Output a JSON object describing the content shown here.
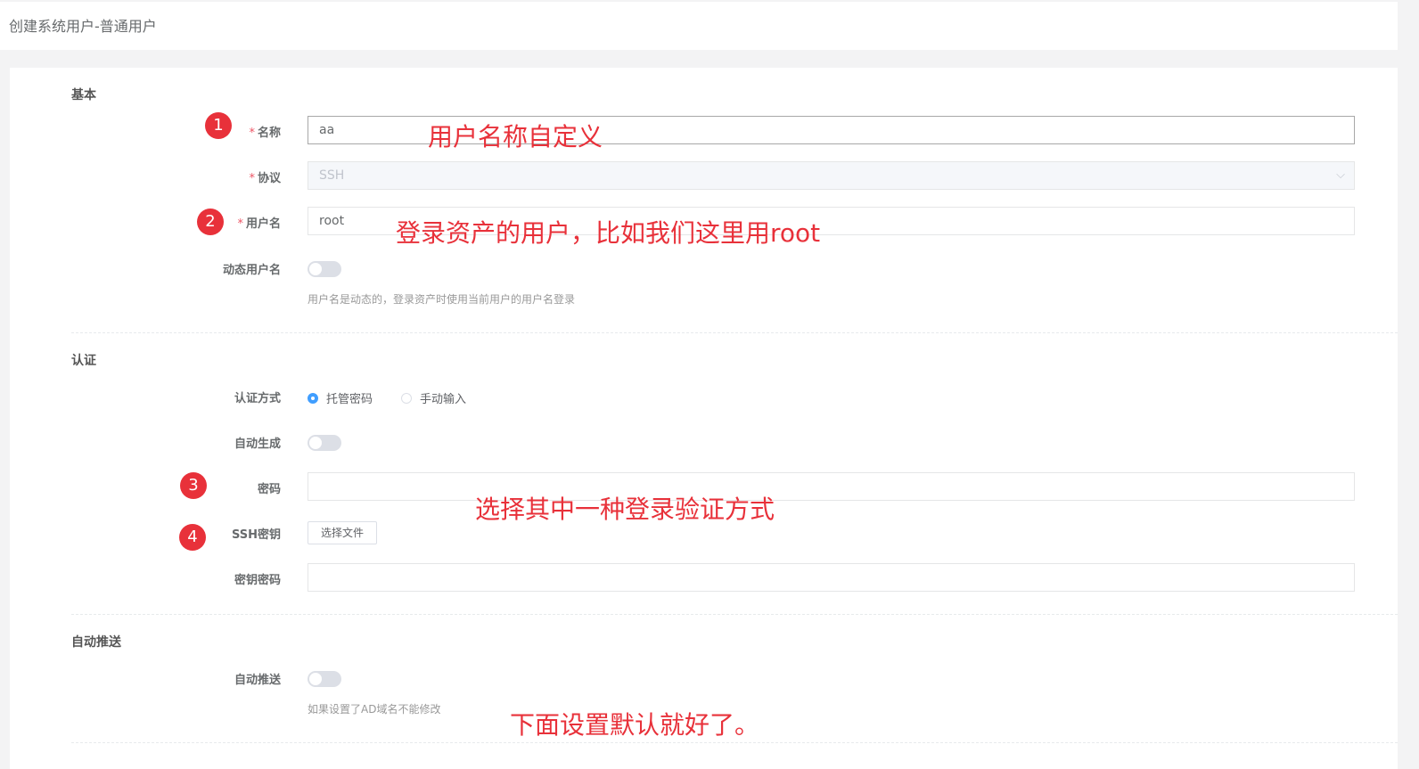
{
  "page": {
    "title": "创建系统用户-普通用户"
  },
  "sections": {
    "basic": {
      "title": "基本",
      "name": {
        "label": "名称",
        "value": "aa"
      },
      "protocol": {
        "label": "协议",
        "value": "SSH"
      },
      "username": {
        "label": "用户名",
        "value": "root"
      },
      "dynamic_username": {
        "label": "动态用户名",
        "enabled": false,
        "help": "用户名是动态的，登录资产时使用当前用户的用户名登录"
      }
    },
    "auth": {
      "title": "认证",
      "method": {
        "label": "认证方式",
        "options": [
          "托管密码",
          "手动输入"
        ],
        "selected": "托管密码"
      },
      "auto_generate": {
        "label": "自动生成",
        "enabled": false
      },
      "password": {
        "label": "密码",
        "value": ""
      },
      "ssh_key": {
        "label": "SSH密钥",
        "button": "选择文件"
      },
      "key_password": {
        "label": "密钥密码",
        "value": ""
      }
    },
    "push": {
      "title": "自动推送",
      "auto_push": {
        "label": "自动推送",
        "enabled": false,
        "help": "如果设置了AD域名不能修改"
      }
    }
  },
  "required_mark": "*",
  "annotations": {
    "badges": [
      "1",
      "2",
      "3",
      "4"
    ],
    "notes": {
      "name": "用户名称自定义",
      "username": "登录资产的用户，比如我们这里用root",
      "auth": "选择其中一种登录验证方式",
      "push": "下面设置默认就好了。"
    },
    "color": "#e8313a"
  }
}
